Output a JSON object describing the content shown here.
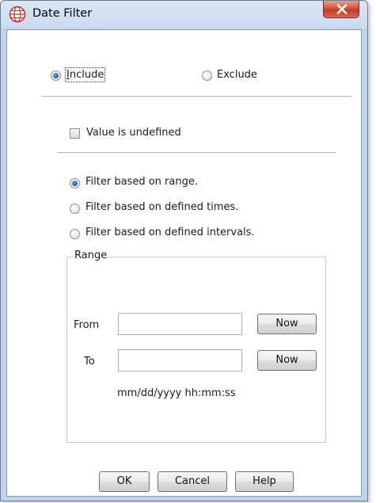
{
  "window": {
    "title": "Date Filter"
  },
  "mode": {
    "include_label": "Include",
    "exclude_label": "Exclude",
    "selected": "include"
  },
  "undefined_checkbox": {
    "label": "Value is undefined",
    "checked": false
  },
  "filter_options": [
    {
      "label": "Filter based on range.",
      "selected": true
    },
    {
      "label": "Filter based on defined times.",
      "selected": false
    },
    {
      "label": "Filter based on defined intervals.",
      "selected": false
    }
  ],
  "range": {
    "legend": "Range",
    "from_label": "From",
    "from_value": "",
    "from_now_label": "Now",
    "to_label": "To",
    "to_value": "",
    "to_now_label": "Now",
    "format_hint": "mm/dd/yyyy hh:mm:ss"
  },
  "footer": {
    "ok_label": "OK",
    "cancel_label": "Cancel",
    "help_label": "Help"
  },
  "colors": {
    "title_bar": "#c9daf0",
    "close_button": "#c8452f",
    "radio_selected": "#2a62b8"
  },
  "icons": {
    "title_icon": "globe-app-icon",
    "close_icon": "close-x-icon"
  }
}
